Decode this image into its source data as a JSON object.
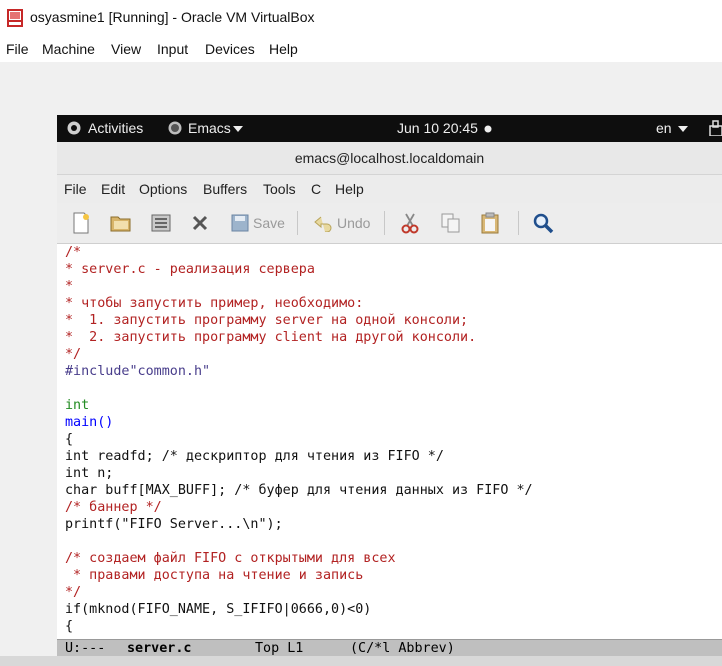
{
  "window": {
    "title": "osyasmine1 [Running] - Oracle VM VirtualBox",
    "menu": [
      "File",
      "Machine",
      "View",
      "Input",
      "Devices",
      "Help"
    ]
  },
  "gnome_topbar": {
    "activities": "Activities",
    "app": "Emacs",
    "clock": "Jun 10  20:45",
    "lang": "en"
  },
  "emacs": {
    "title": "emacs@localhost.localdomain",
    "menu": [
      "File",
      "Edit",
      "Options",
      "Buffers",
      "Tools",
      "C",
      "Help"
    ],
    "toolbar": {
      "new_icon": "new-file-icon",
      "open_icon": "open-folder-icon",
      "dired_icon": "dired-icon",
      "close_icon": "close-icon",
      "save_label": "Save",
      "undo_label": "Undo",
      "cut_icon": "cut-icon",
      "copy_icon": "copy-icon",
      "paste_icon": "paste-icon",
      "search_icon": "search-icon"
    },
    "code_lines": [
      "/*",
      "* server.c - реализация сервера",
      "*",
      "* чтобы запустить пример, необходимо:",
      "*  1. запустить программу server на одной консоли;",
      "*  2. запустить программу client на другой консоли.",
      "*/",
      "#include\"common.h\"",
      "",
      "int",
      "main()",
      "{",
      "int readfd; /* дескриптор для чтения из FIFO */",
      "int n;",
      "char buff[MAX_BUFF]; /* буфер для чтения данных из FIFO */",
      "/* баннер */",
      "printf(\"FIFO Server...\\n\");",
      "",
      "/* создаем файл FIFO с открытыми для всех",
      " * правами доступа на чтение и запись",
      "*/",
      "if(mknod(FIFO_NAME, S_IFIFO|0666,0)<0)",
      "{"
    ],
    "modeline": {
      "status": "U:---",
      "buffer": "server.c",
      "position": "Top L1",
      "modes": "(C/*l Abbrev)"
    }
  }
}
